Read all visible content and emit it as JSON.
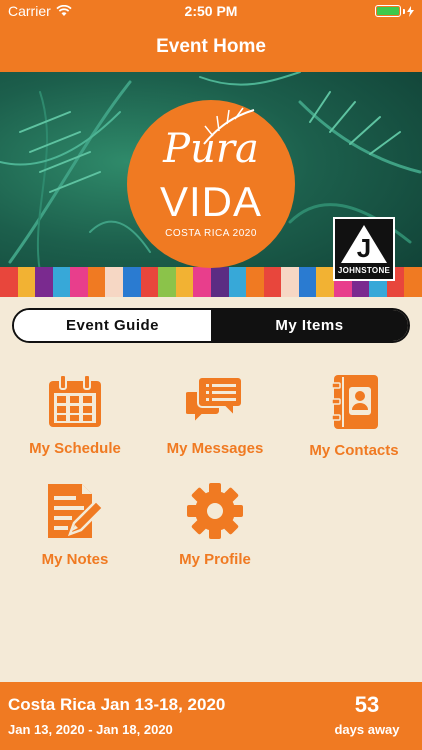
{
  "status": {
    "carrier": "Carrier",
    "time": "2:50 PM"
  },
  "nav": {
    "title": "Event Home"
  },
  "banner": {
    "logo_line1": "Pura",
    "logo_line2": "VIDA",
    "logo_line3": "COSTA RICA 2020",
    "brand": "JOHNSTONE",
    "brand_mark": "J"
  },
  "tabs": [
    {
      "label": "Event Guide",
      "active": false
    },
    {
      "label": "My Items",
      "active": true
    }
  ],
  "tiles": [
    {
      "label": "My Schedule",
      "icon": "calendar-icon"
    },
    {
      "label": "My Messages",
      "icon": "chat-bubbles-icon"
    },
    {
      "label": "My Contacts",
      "icon": "address-book-icon"
    },
    {
      "label": "My Notes",
      "icon": "notes-icon"
    },
    {
      "label": "My Profile",
      "icon": "gear-icon"
    }
  ],
  "footer": {
    "event_title": "Costa Rica Jan 13-18, 2020",
    "event_dates": "Jan 13, 2020 - Jan 18, 2020",
    "countdown_value": "53",
    "countdown_unit": "days away"
  },
  "colors": {
    "accent": "#f07a22",
    "background": "#f4ead7",
    "dark": "#111111"
  }
}
